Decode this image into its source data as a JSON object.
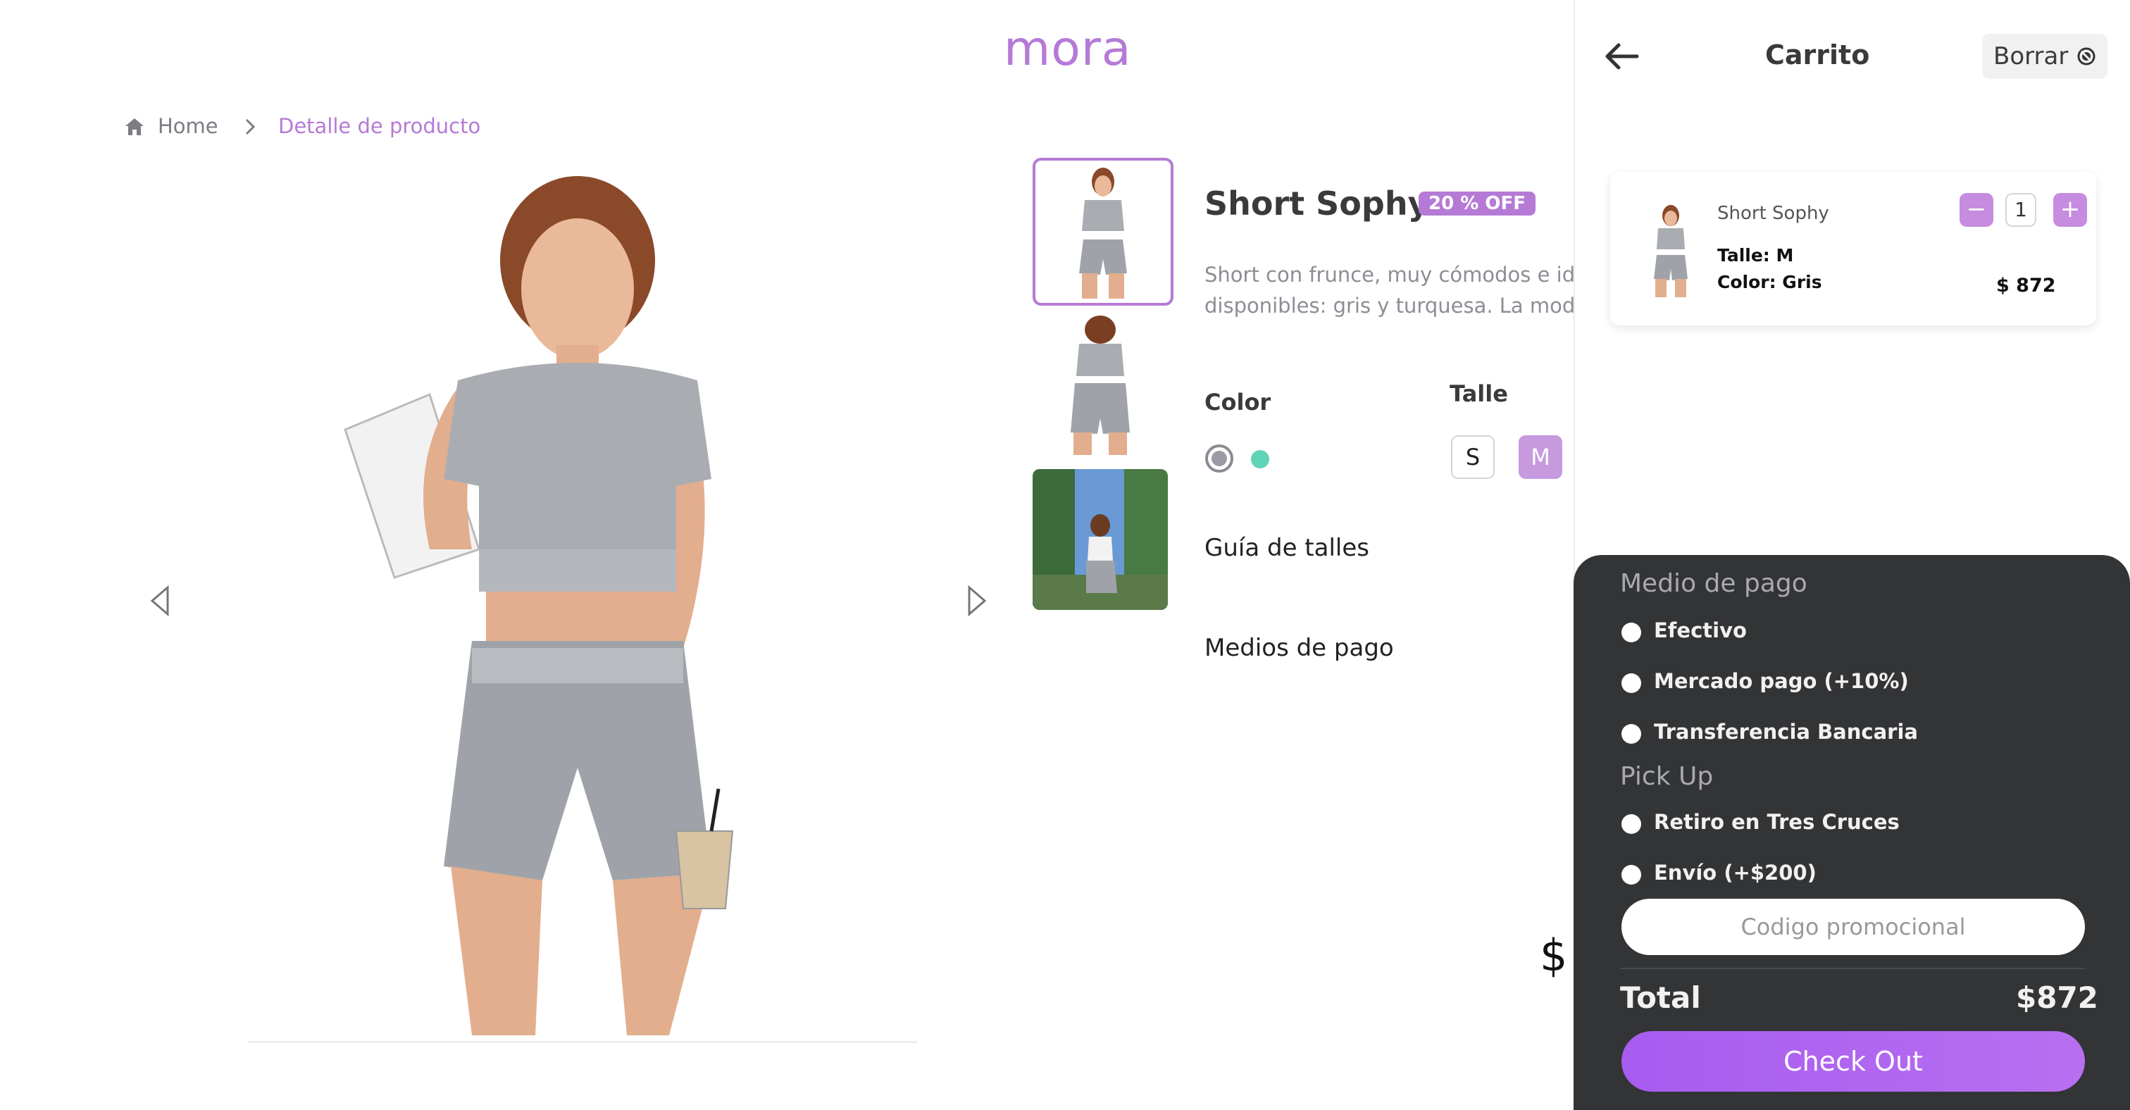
{
  "brand": {
    "logo_text": "mora",
    "accent_color": "#b57ad6"
  },
  "breadcrumb": {
    "home_icon": "home-icon",
    "home": "Home",
    "separator_icon": "chevron-right-icon",
    "current": "Detalle de producto"
  },
  "product": {
    "name": "Short Sophy",
    "badge": "20 % OFF",
    "description_line1": "Short con frunce, muy cómodos e ide",
    "description_line2": "disponibles: gris y turquesa. La mode",
    "color_label": "Color",
    "colors": [
      {
        "name": "gris",
        "hex": "#9b9ba5",
        "selected": true
      },
      {
        "name": "turquesa",
        "hex": "#5fd3b5",
        "selected": false
      }
    ],
    "size_label": "Talle",
    "sizes": [
      {
        "label": "S",
        "selected": false
      },
      {
        "label": "M",
        "selected": true
      }
    ],
    "size_guide": "Guía de talles",
    "payment_methods": "Medios de pago",
    "price_symbol": "$"
  },
  "cart": {
    "back_icon": "arrow-left-icon",
    "title": "Carrito",
    "clear_label": "Borrar",
    "clear_icon": "clear-icon",
    "item": {
      "name": "Short Sophy",
      "talle": "Talle: M",
      "color": "Color: Gris",
      "price": "$ 872",
      "qty": "1",
      "minus": "−",
      "plus": "+"
    }
  },
  "payment": {
    "title": "Medio de pago",
    "options": [
      "Efectivo",
      "Mercado pago (+10%)",
      "Transferencia Bancaria"
    ],
    "pickup_title": "Pick Up",
    "pickup_options": [
      "Retiro en Tres Cruces",
      "Envío (+$200)"
    ],
    "promo_placeholder": "Codigo promocional",
    "total_label": "Total",
    "total_value": "$872",
    "checkout_label": "Check Out"
  }
}
